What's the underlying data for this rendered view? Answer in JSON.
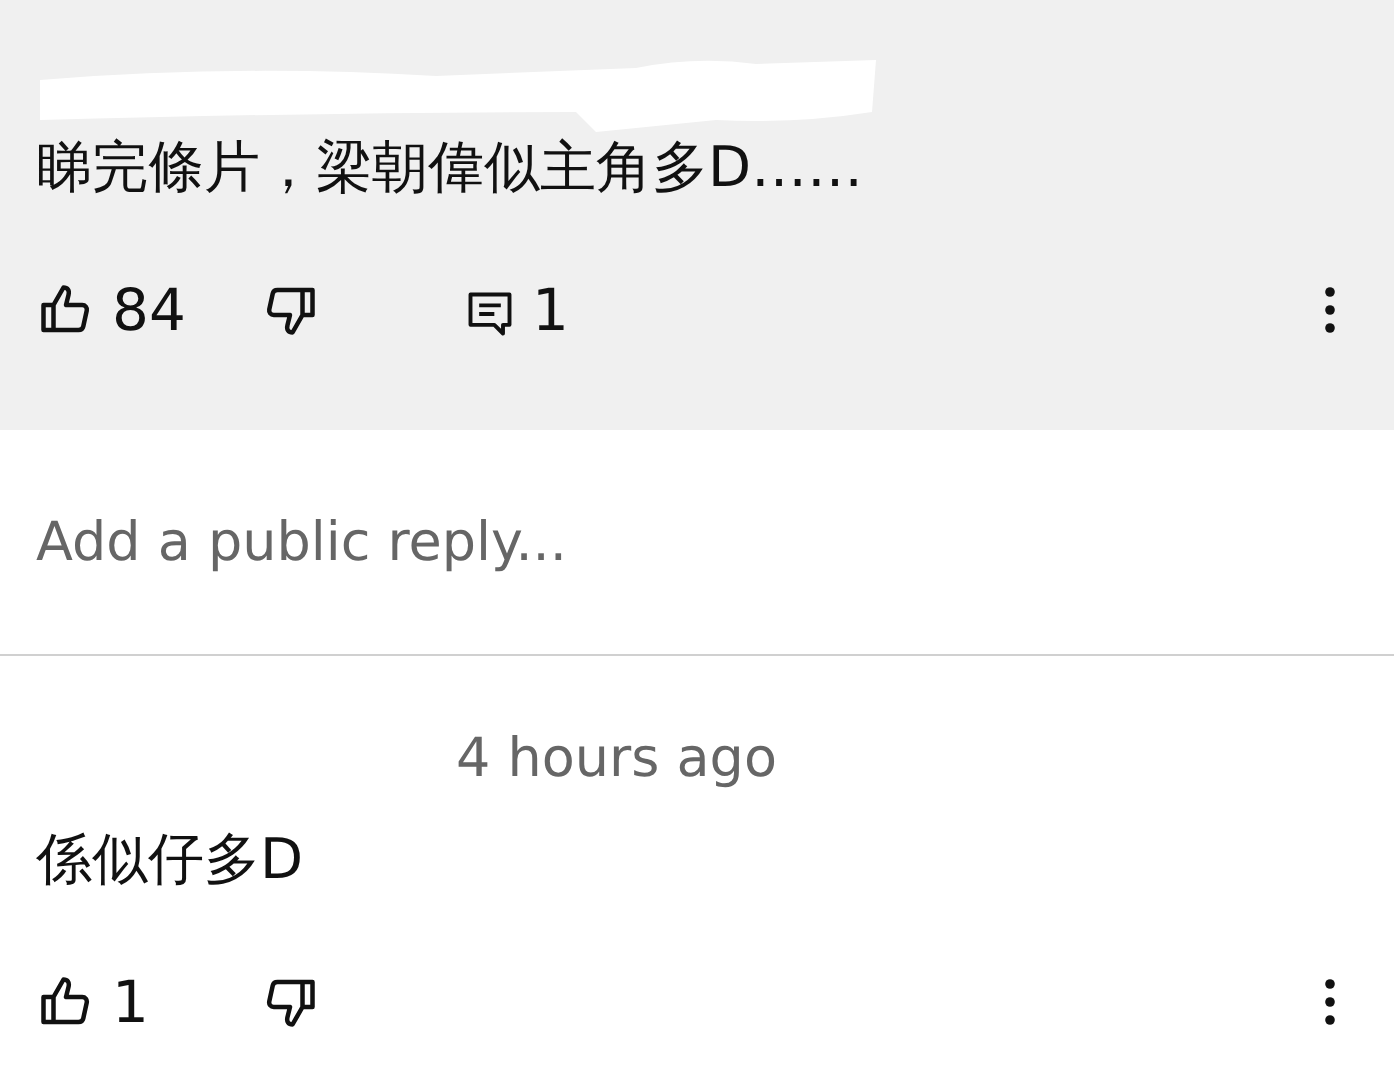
{
  "comment": {
    "author_redacted": true,
    "text": "睇完條片，梁朝偉似主角多D……",
    "likes": "84",
    "replies": "1"
  },
  "reply_field": {
    "placeholder": "Add a public reply..."
  },
  "replies": [
    {
      "time": "4 hours ago",
      "text": "係似仔多D",
      "likes": "1"
    }
  ]
}
